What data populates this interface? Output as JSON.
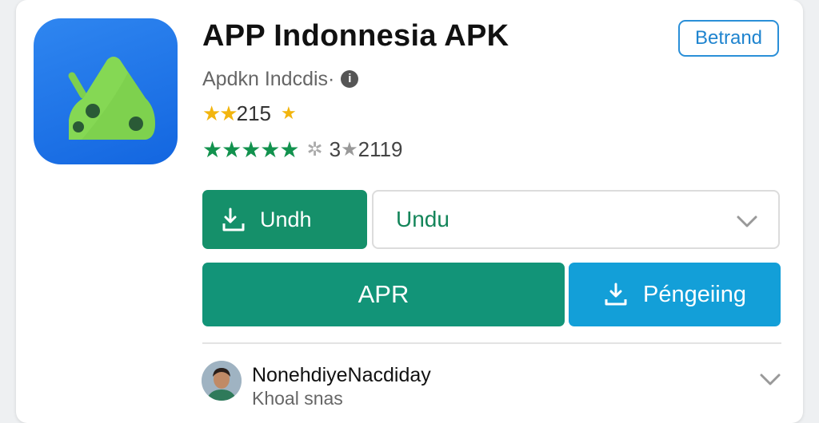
{
  "app": {
    "title": "APP Indonnesia APK",
    "developer": "Apdkn Indcdis·",
    "badge": "Betrand"
  },
  "rating": {
    "gold_stars": "★★",
    "value_text": "215",
    "extra_star": "★",
    "green_stars": "★★★★★",
    "review_prefix": "3",
    "review_star": "★",
    "review_count": "2119"
  },
  "buttons": {
    "install_label": "Undh",
    "select_value": "Undu",
    "apk_label": "APR",
    "secondary_label": "Péngeiing"
  },
  "user": {
    "name": "NonehdiyeNacdiday",
    "subtitle": "Khoal snas"
  },
  "colors": {
    "install_green": "#15906a",
    "apk_green": "#129478",
    "blue_button": "#139fd8",
    "star_gold": "#f2b50e",
    "star_green": "#12924e",
    "icon_blue": "#1366e0"
  },
  "icons": {
    "app_icon": "android-robot-icon",
    "download": "download-icon",
    "secondary": "download-tray-icon",
    "chevron": "chevron-down-icon"
  }
}
